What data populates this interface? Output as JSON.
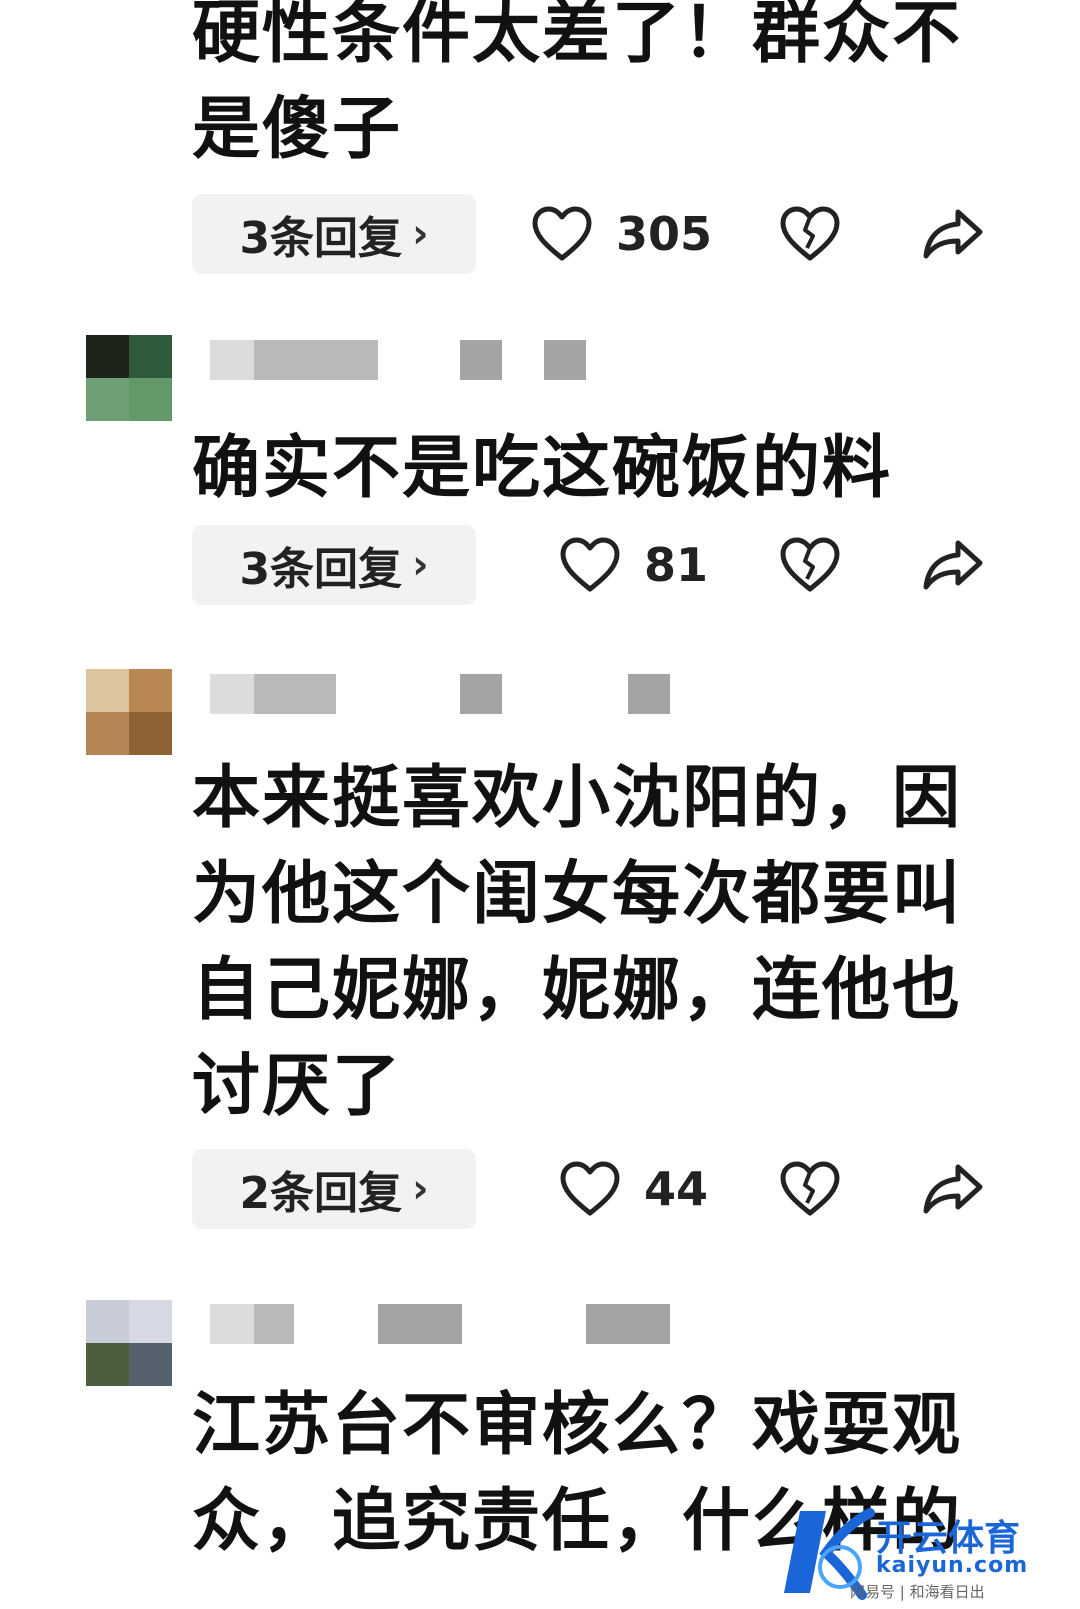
{
  "comments": [
    {
      "text": "硬性条件太差了！群众不是傻子",
      "reply_label": "3条回复",
      "likes": "305",
      "avatar_colors": []
    },
    {
      "text": "确实不是吃这碗饭的料",
      "reply_label": "3条回复",
      "likes": "81",
      "avatar_colors": [
        "#1e2418",
        "#2f5a3c",
        "#6f9f77",
        "#63986b"
      ]
    },
    {
      "text": "本来挺喜欢小沈阳的，因为他这个闺女每次都要叫自己妮娜，妮娜，连他也讨厌了",
      "reply_label": "2条回复",
      "likes": "44",
      "avatar_colors": [
        "#dcc49c",
        "#b98754",
        "#b58556",
        "#8f6236"
      ]
    },
    {
      "text": "江苏台不审核么？戏耍观众，追究责任，什么样的",
      "avatar_colors": [
        "#c8cbd8",
        "#d6d9e3",
        "#4b5e3f",
        "#55626e"
      ]
    }
  ],
  "icons": {
    "like": "heart-outline-icon",
    "dislike": "broken-heart-icon",
    "share": "share-arrow-icon",
    "reply_more": "chevron-right-icon"
  },
  "colors": {
    "text": "#111111",
    "reply_bg": "#f2f2f2",
    "icon_stroke": "#222222",
    "watermark": "#1a66d8"
  },
  "watermark": {
    "brand": "开云体育",
    "url": "kaiyun.com",
    "note": "网易号 | 和海看日出"
  }
}
